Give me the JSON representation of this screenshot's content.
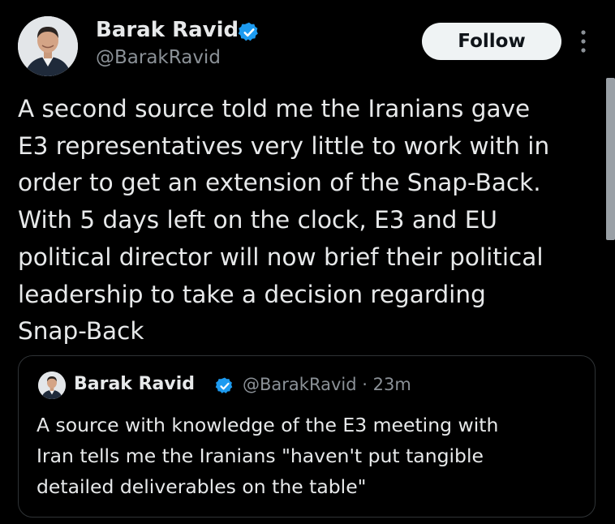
{
  "author": {
    "name": "Barak Ravid",
    "handle": "@BarakRavid"
  },
  "actions": {
    "follow_label": "Follow",
    "more_icon": "more-vertical-icon"
  },
  "icons": {
    "verified": "verified-badge-icon",
    "verified_color": "#1d9bf0"
  },
  "tweet": {
    "lines": [
      "A second source told me the Iranians gave",
      "E3 representatives very little to work with in",
      "order to get an extension of the Snap-Back.",
      "With 5 days left on the clock, E3 and EU",
      "political director will now brief their political",
      "leadership to take a decision regarding",
      "Snap-Back"
    ]
  },
  "quoted_tweet": {
    "name": "Barak Ravid",
    "handle": "@BarakRavid",
    "separator": "·",
    "time": "23m",
    "lines": [
      "A source with knowledge of the E3 meeting with",
      "Iran tells me the Iranians \"haven't put tangible",
      "detailed deliverables on the table\""
    ]
  }
}
